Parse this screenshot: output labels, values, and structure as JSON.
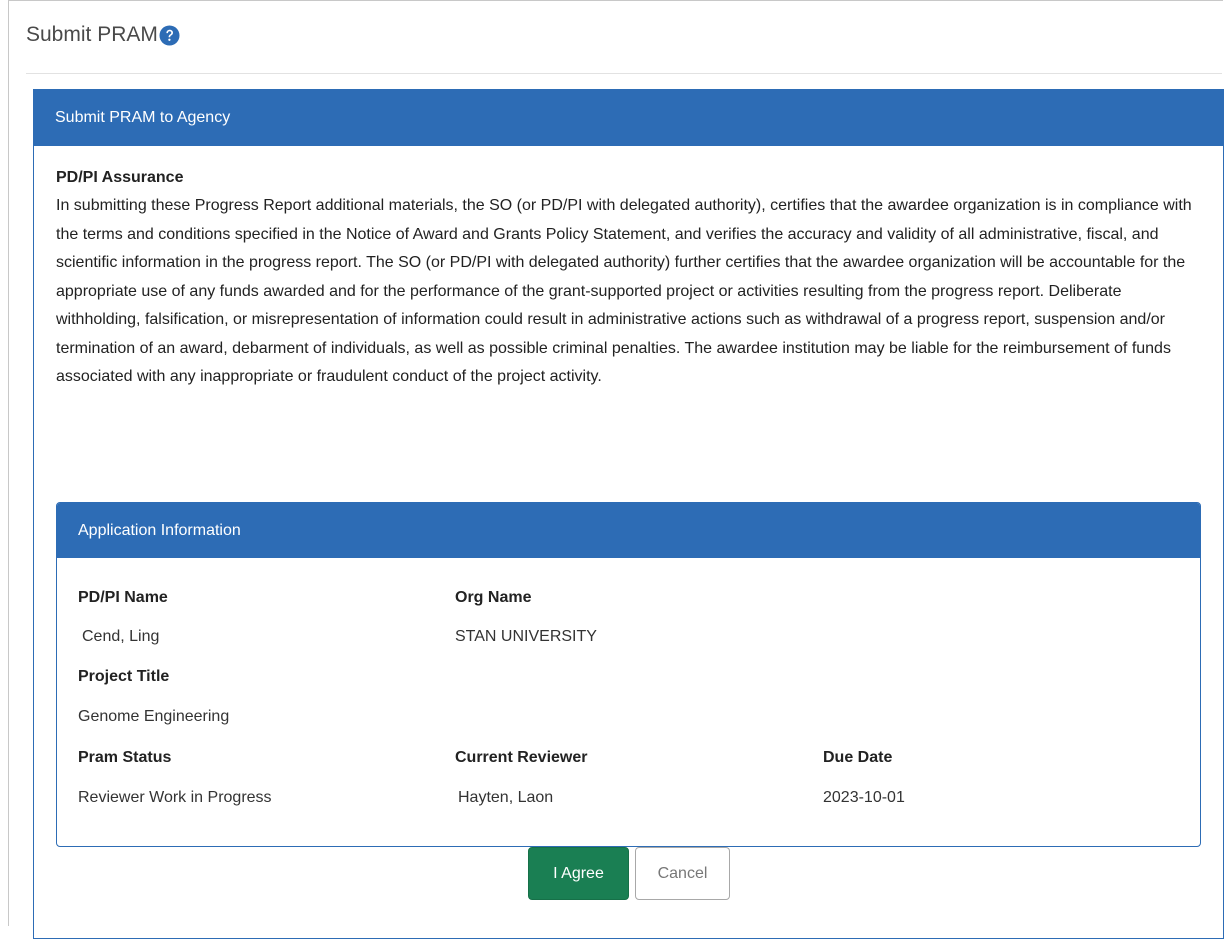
{
  "page": {
    "title": "Submit PRAM",
    "help_icon": "question-circle-icon"
  },
  "submit_panel": {
    "header": "Submit PRAM to Agency",
    "assurance_title": "PD/PI Assurance",
    "assurance_text": "In submitting these Progress Report additional materials, the SO (or PD/PI with delegated authority), certifies that the awardee organization is in compliance with the terms and conditions specified in the Notice of Award and Grants Policy Statement, and verifies the accuracy and validity of all administrative, fiscal, and scientific information in the progress report. The SO (or PD/PI with delegated authority) further certifies that the awardee organization will be accountable for the appropriate use of any funds awarded and for the performance of the grant-supported project or activities resulting from the progress report. Deliberate withholding, falsification, or misrepresentation of information could result in administrative actions such as withdrawal of a progress report, suspension and/or termination of an award, debarment of individuals, as well as possible criminal penalties. The awardee institution may be liable for the reimbursement of funds associated with any inappropriate or fraudulent conduct of the project activity."
  },
  "application_info": {
    "header": "Application Information",
    "pdpi_name_label": "PD/PI Name",
    "pdpi_name_value": "Cend, Ling",
    "org_name_label": "Org Name",
    "org_name_value": "STAN UNIVERSITY",
    "project_title_label": "Project Title",
    "project_title_value": "Genome Engineering",
    "pram_status_label": "Pram Status",
    "pram_status_value": "Reviewer Work in Progress",
    "current_reviewer_label": "Current Reviewer",
    "current_reviewer_value": "Hayten, Laon",
    "due_date_label": "Due Date",
    "due_date_value": "2023-10-01"
  },
  "actions": {
    "agree_label": "I Agree",
    "cancel_label": "Cancel"
  },
  "colors": {
    "panel_header": "#2d6cb5",
    "agree_button": "#1a7f53"
  }
}
